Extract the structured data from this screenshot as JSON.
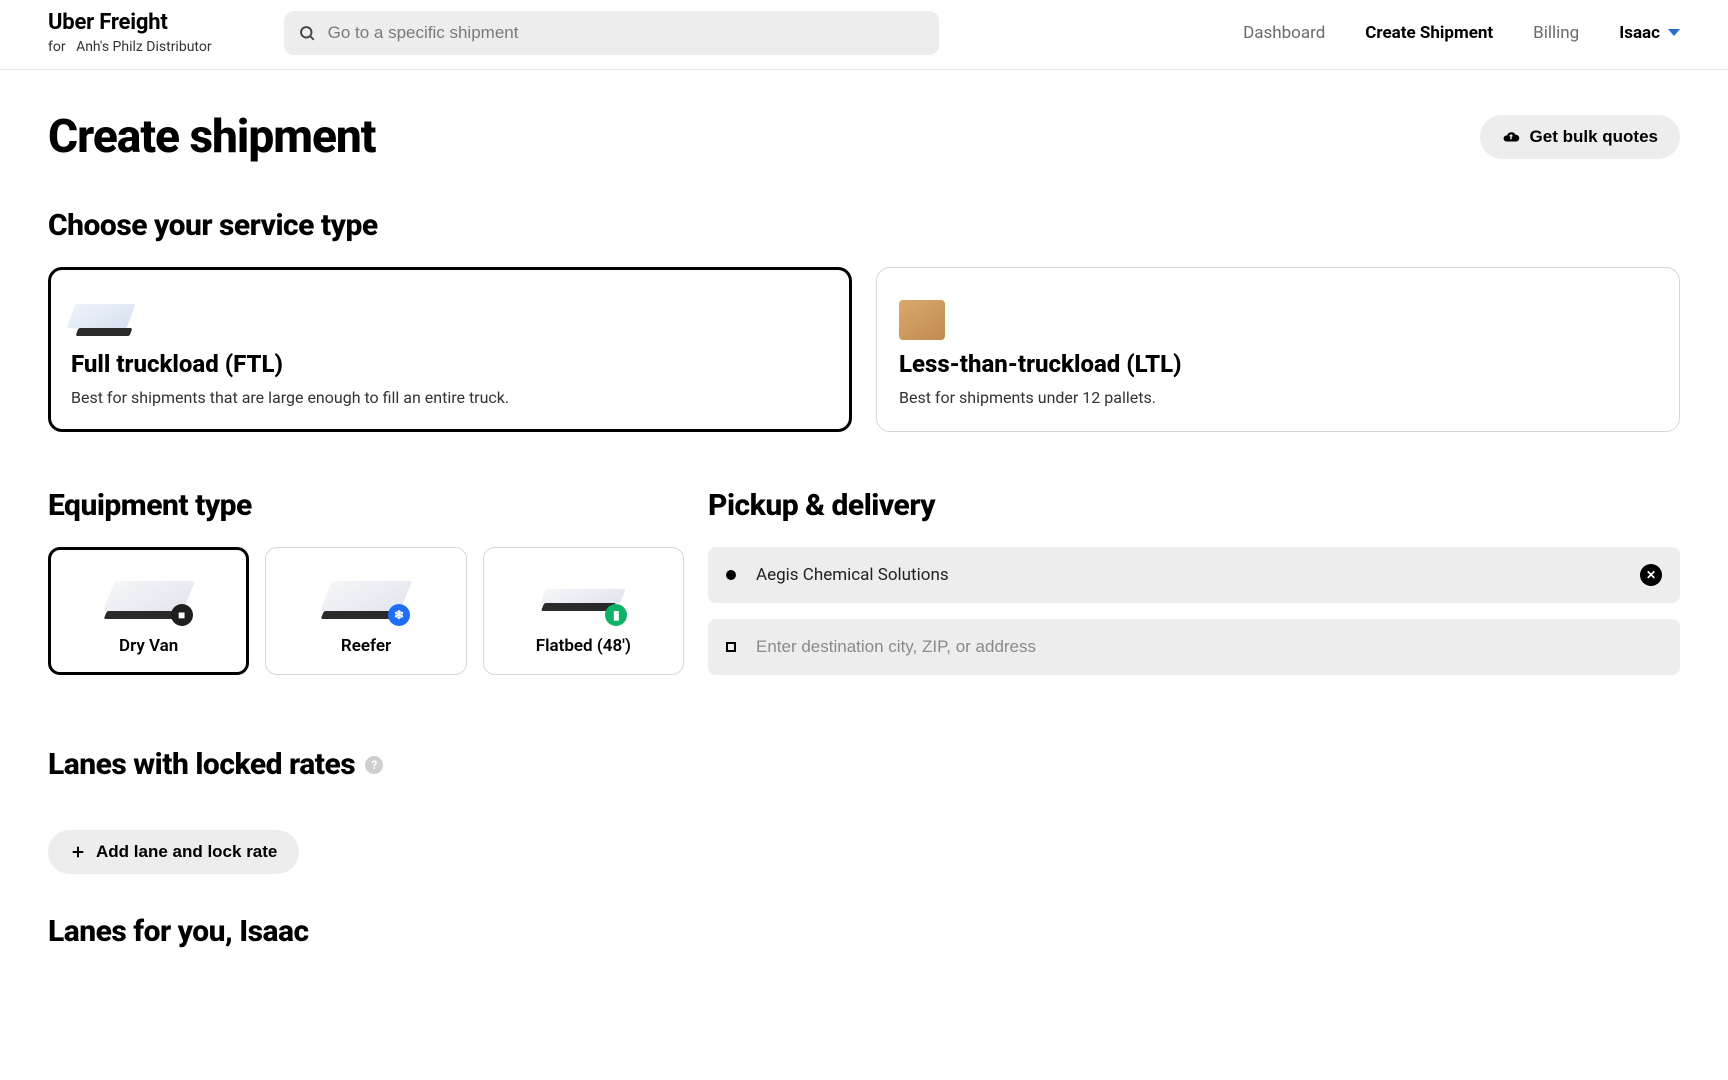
{
  "header": {
    "brand": "Uber Freight",
    "for_prefix": "for",
    "org": "Anh's Philz Distributor",
    "search_placeholder": "Go to a specific shipment",
    "nav": {
      "dashboard": "Dashboard",
      "create_shipment": "Create Shipment",
      "billing": "Billing"
    },
    "user": "Isaac"
  },
  "page": {
    "title": "Create shipment",
    "bulk_button": "Get bulk quotes"
  },
  "service": {
    "heading": "Choose your service type",
    "ftl": {
      "title": "Full truckload (FTL)",
      "desc": "Best for shipments that are large enough to fill an entire truck."
    },
    "ltl": {
      "title": "Less-than-truckload (LTL)",
      "desc": "Best for shipments under 12 pallets."
    }
  },
  "equipment": {
    "heading": "Equipment type",
    "dry_van": "Dry Van",
    "reefer": "Reefer",
    "flatbed": "Flatbed (48')"
  },
  "pickup": {
    "heading": "Pickup & delivery",
    "origin_value": "Aegis Chemical Solutions",
    "dest_placeholder": "Enter destination city, ZIP, or address"
  },
  "lanes": {
    "heading": "Lanes with locked rates",
    "add_button": "Add lane and lock rate",
    "for_you": "Lanes for you, Isaac"
  }
}
